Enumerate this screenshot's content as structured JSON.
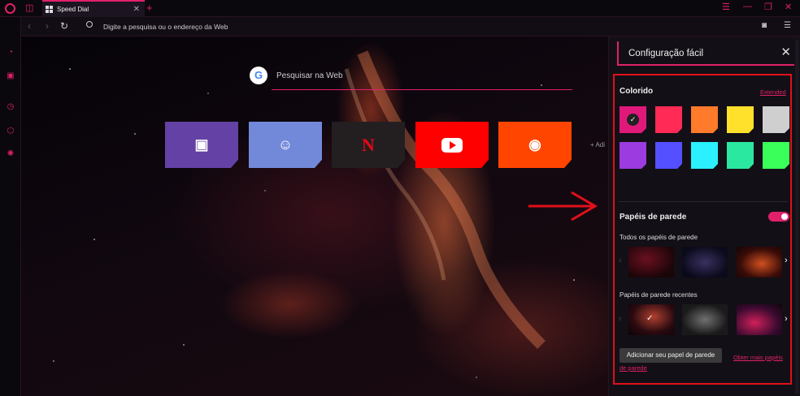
{
  "colors": {
    "accent": "#e0206a",
    "highlight": "#e0101a"
  },
  "titlebar": {
    "tab_title": "Speed Dial",
    "tab_close": "✕",
    "new_tab": "+",
    "menu_icon": "☰",
    "minimize": "—",
    "maximize": "❐",
    "close": "✕"
  },
  "addressbar": {
    "back": "‹",
    "forward": "›",
    "reload": "↻",
    "placeholder": "Digite a pesquisa ou o endereço da Web",
    "snapshot_icon": "camera-icon",
    "settings_icon": "sliders-icon"
  },
  "sidebar": {
    "items": [
      {
        "icon": "speedometer-icon",
        "glyph": "◔"
      },
      {
        "icon": "twitch-icon",
        "glyph": "▣"
      },
      {
        "icon": "clock-icon",
        "glyph": "◷"
      },
      {
        "icon": "cube-icon",
        "glyph": "⬡"
      },
      {
        "icon": "gear-icon",
        "glyph": "✺"
      }
    ]
  },
  "search": {
    "google_glyph": "G",
    "placeholder": "Pesquisar na Web"
  },
  "speed_dial": {
    "tiles": [
      {
        "name": "twitch",
        "glyph": "▣",
        "color": "#6441a4"
      },
      {
        "name": "discord",
        "glyph": "☺",
        "color": "#7289da"
      },
      {
        "name": "netflix",
        "glyph": "N",
        "color": "#231f20"
      },
      {
        "name": "youtube",
        "glyph": "",
        "color": "#ff0000"
      },
      {
        "name": "reddit",
        "glyph": "◉",
        "color": "#ff4500"
      }
    ],
    "add_label": "+ Adi"
  },
  "panel": {
    "title": "Configuração fácil",
    "close": "✕",
    "colors_section": {
      "title": "Colorido",
      "extended_link": "Extended",
      "swatches": [
        "#e0187a",
        "#ff2a55",
        "#ff7a2a",
        "#ffe02a",
        "#cfcfcf",
        "#9b3be0",
        "#5450ff",
        "#2af0ff",
        "#2ae8a0",
        "#3aff5a"
      ],
      "selected_index": 0,
      "check_glyph": "✓"
    },
    "wallpapers_section": {
      "title": "Papéis de parede",
      "enabled": true,
      "all_title": "Todos os papéis de parede",
      "recent_title": "Papéis de parede recentes",
      "prev": "‹",
      "next": "›",
      "check_glyph": "✓",
      "add_button": "Adicionar seu papel de parede",
      "more_link": "Obter mais papéis de parede"
    }
  }
}
